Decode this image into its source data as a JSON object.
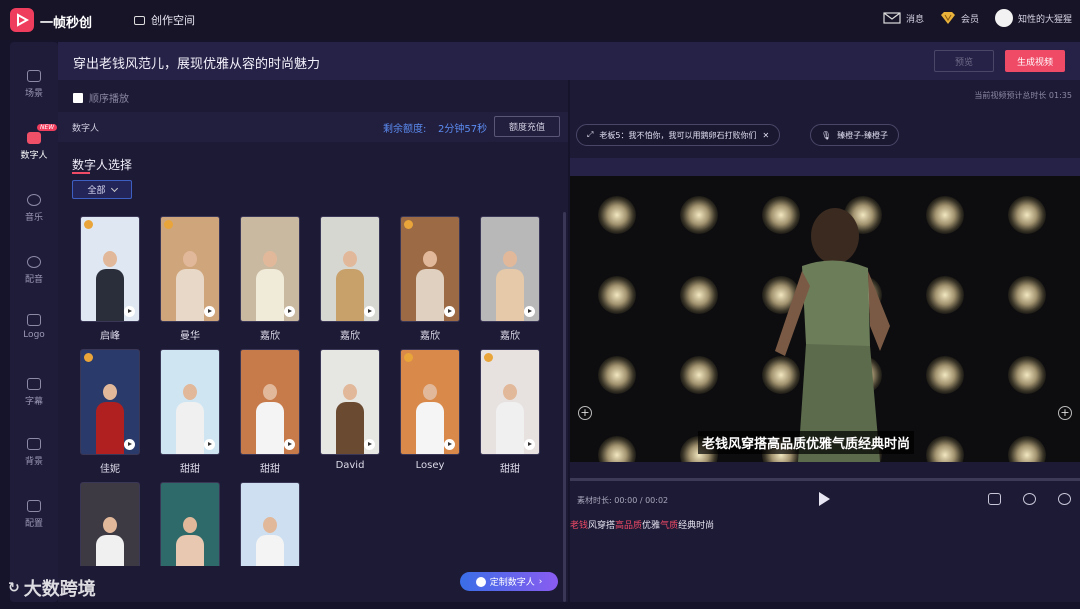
{
  "app": {
    "name": "一帧秒创",
    "create_space": "创作空间"
  },
  "top_right": {
    "messages": "消息",
    "member": "会员",
    "username": "知性的大猩猩"
  },
  "sidebar": {
    "items": [
      {
        "label": "场景",
        "icon": "scene-icon"
      },
      {
        "label": "数字人",
        "icon": "digital-human-icon",
        "badge": "NEW",
        "active": true
      },
      {
        "label": "音乐",
        "icon": "music-icon"
      },
      {
        "label": "配音",
        "icon": "voiceover-icon"
      },
      {
        "label": "Logo",
        "icon": "logo-icon"
      },
      {
        "label": "字幕",
        "icon": "subtitle-icon"
      },
      {
        "label": "背景",
        "icon": "background-icon"
      },
      {
        "label": "配置",
        "icon": "config-icon"
      }
    ]
  },
  "header": {
    "title": "穿出老钱风范儿，展现优雅从容的时尚魅力",
    "preview_label": "预览",
    "generate_label": "生成视频"
  },
  "left": {
    "sequential_play": "顺序播放",
    "section_tab": "数字人",
    "quota_label": "剩余额度:",
    "quota_value": "2分钟57秒",
    "recharge_label": "额度充值",
    "select_title": "数字人选择",
    "filter_label": "全部",
    "avatars": [
      {
        "name": "启峰",
        "crown": true
      },
      {
        "name": "曼华",
        "crown": true
      },
      {
        "name": "嘉欣",
        "crown": false
      },
      {
        "name": "嘉欣",
        "crown": false
      },
      {
        "name": "嘉欣",
        "crown": true
      },
      {
        "name": "嘉欣",
        "crown": false
      },
      {
        "name": "佳妮",
        "crown": true
      },
      {
        "name": "甜甜",
        "crown": false
      },
      {
        "name": "甜甜",
        "crown": false
      },
      {
        "name": "David",
        "crown": false
      },
      {
        "name": "Losey",
        "crown": true
      },
      {
        "name": "甜甜",
        "crown": true
      },
      {
        "name": "",
        "crown": false
      },
      {
        "name": "",
        "crown": false
      },
      {
        "name": "",
        "crown": false
      }
    ],
    "custom_button": "定制数字人"
  },
  "right": {
    "total_duration": "当前视频预计总时长 01:35",
    "chip_script": "老板5：我不怕你，我可以用鹅卵石打败你们",
    "chip_voice": "臻橙子-臻橙子",
    "video_subtitle": "老钱风穿搭高品质优雅气质经典时尚",
    "material_duration": "素材时长: 00:00 / 00:02",
    "subtitle_parts": [
      {
        "t": "老钱",
        "hl": true
      },
      {
        "t": "风穿搭",
        "hl": false
      },
      {
        "t": "高品质",
        "hl": true
      },
      {
        "t": "优雅",
        "hl": false
      },
      {
        "t": "气质",
        "hl": true
      },
      {
        "t": "经典时尚",
        "hl": false
      }
    ]
  },
  "watermark": "大数跨境",
  "colors": {
    "accent": "#ef4a66",
    "link": "#5b8cf0",
    "bg": "#1d1a35"
  }
}
